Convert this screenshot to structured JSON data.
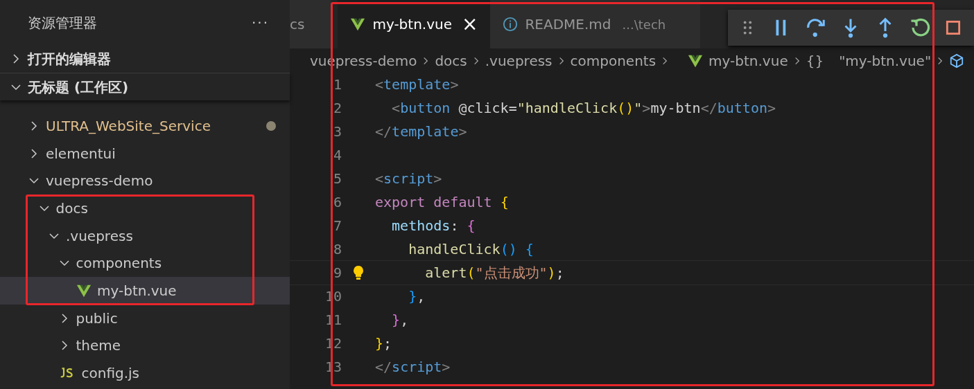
{
  "sidebar": {
    "title": "资源管理器",
    "more": "···",
    "sections": [
      {
        "label": "打开的编辑器",
        "expanded": false
      },
      {
        "label": "无标题 (工作区)",
        "expanded": true
      }
    ],
    "tree": [
      {
        "label": "ULTRA_WebSite_Service",
        "kind": "folder",
        "expanded": false,
        "selected": false,
        "modified": true
      },
      {
        "label": "elementui",
        "kind": "folder",
        "expanded": false,
        "selected": false,
        "modified": false
      },
      {
        "label": "vuepress-demo",
        "kind": "folder",
        "expanded": true,
        "selected": false,
        "modified": false,
        "children": [
          {
            "label": "docs",
            "kind": "folder",
            "expanded": true,
            "selected": false,
            "modified": false,
            "children": [
              {
                "label": ".vuepress",
                "kind": "folder",
                "expanded": true,
                "selected": false,
                "modified": false,
                "children": [
                  {
                    "label": "components",
                    "kind": "folder",
                    "expanded": true,
                    "selected": false,
                    "modified": false,
                    "children": [
                      {
                        "label": "my-btn.vue",
                        "kind": "vue",
                        "selected": true,
                        "modified": false
                      }
                    ]
                  },
                  {
                    "label": "public",
                    "kind": "folder",
                    "expanded": false,
                    "selected": false,
                    "modified": false
                  },
                  {
                    "label": "theme",
                    "kind": "folder",
                    "expanded": false,
                    "selected": false,
                    "modified": false
                  },
                  {
                    "label": "config.js",
                    "kind": "js",
                    "selected": false,
                    "modified": false
                  }
                ]
              }
            ]
          }
        ]
      }
    ]
  },
  "tabs": [
    {
      "label": "cs",
      "kind": "plain",
      "selected": false
    },
    {
      "label": "my-btn.vue",
      "kind": "vue",
      "selected": true,
      "close": "×"
    },
    {
      "label": "README.md",
      "kind": "info",
      "selected": false,
      "description": "...\\tech"
    }
  ],
  "breadcrumb": [
    {
      "label": "vuepress-demo",
      "kind": "plain"
    },
    {
      "label": "docs",
      "kind": "plain"
    },
    {
      "label": ".vuepress",
      "kind": "plain"
    },
    {
      "label": "components",
      "kind": "plain"
    },
    {
      "label": "my-btn.vue",
      "kind": "vue"
    },
    {
      "label": "\"my-btn.vue\"",
      "kind": "braces",
      "icon": "{}"
    },
    {
      "kind": "cube"
    }
  ],
  "code": {
    "lines": [
      {
        "number": "1",
        "tokens": [
          {
            "t": "<",
            "kind": "bracket"
          },
          {
            "t": "template",
            "kind": "tag"
          },
          {
            "t": ">",
            "kind": "bracket"
          }
        ]
      },
      {
        "number": "2",
        "tokens": [
          {
            "t": "  <",
            "kind": "bracket"
          },
          {
            "t": "button",
            "kind": "tag"
          },
          {
            "t": " @click=",
            "kind": "plain"
          },
          {
            "t": "\"handleClick",
            "kind": "func"
          },
          {
            "t": "()",
            "kind": "brace1"
          },
          {
            "t": "\"",
            "kind": "func"
          },
          {
            "t": ">",
            "kind": "bracket"
          },
          {
            "t": "my-btn",
            "kind": "plain"
          },
          {
            "t": "</",
            "kind": "bracket"
          },
          {
            "t": "button",
            "kind": "tag"
          },
          {
            "t": ">",
            "kind": "bracket"
          }
        ]
      },
      {
        "number": "3",
        "tokens": [
          {
            "t": "</",
            "kind": "bracket"
          },
          {
            "t": "template",
            "kind": "tag"
          },
          {
            "t": ">",
            "kind": "bracket"
          }
        ]
      },
      {
        "number": "4"
      },
      {
        "number": "5",
        "tokens": [
          {
            "t": "<",
            "kind": "bracket"
          },
          {
            "t": "script",
            "kind": "tag"
          },
          {
            "t": ">",
            "kind": "bracket"
          }
        ]
      },
      {
        "number": "6",
        "tokens": [
          {
            "t": "export default ",
            "kind": "keyword"
          },
          {
            "t": "{",
            "kind": "brace1"
          }
        ]
      },
      {
        "number": "7",
        "tokens": [
          {
            "t": "  methods",
            "kind": "prop"
          },
          {
            "t": ": ",
            "kind": "plain"
          },
          {
            "t": "{",
            "kind": "brace2"
          }
        ]
      },
      {
        "number": "8",
        "tokens": [
          {
            "t": "    handleClick",
            "kind": "func"
          },
          {
            "t": "() {",
            "kind": "brace3"
          }
        ]
      },
      {
        "number": "9",
        "current": true,
        "hint": true,
        "tokens": [
          {
            "t": "      alert",
            "kind": "func"
          },
          {
            "t": "(",
            "kind": "brace1"
          },
          {
            "t": "\"点击成功\"",
            "kind": "string"
          },
          {
            "t": ")",
            "kind": "brace1"
          },
          {
            "t": ";",
            "kind": "plain"
          }
        ]
      },
      {
        "number": "10",
        "tokens": [
          {
            "t": "    }",
            "kind": "brace3"
          },
          {
            "t": ",",
            "kind": "plain"
          }
        ]
      },
      {
        "number": "11",
        "tokens": [
          {
            "t": "  }",
            "kind": "brace2"
          },
          {
            "t": ",",
            "kind": "plain"
          }
        ]
      },
      {
        "number": "12",
        "tokens": [
          {
            "t": "}",
            "kind": "brace1"
          },
          {
            "t": ";",
            "kind": "plain"
          }
        ]
      },
      {
        "number": "13",
        "tokens": [
          {
            "t": "</",
            "kind": "bracket"
          },
          {
            "t": "script",
            "kind": "tag"
          },
          {
            "t": ">",
            "kind": "bracket"
          }
        ]
      }
    ]
  }
}
